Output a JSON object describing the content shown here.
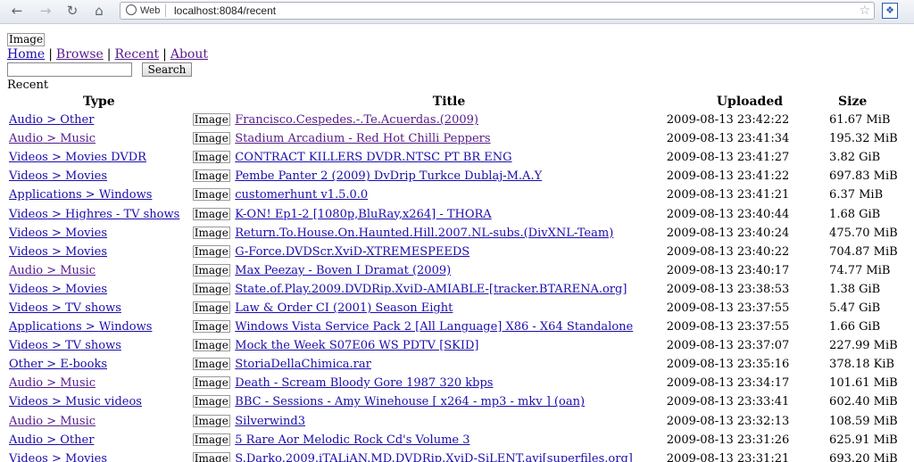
{
  "browser": {
    "url_chip": "Web",
    "url": "localhost:8084/recent"
  },
  "page": {
    "logo_alt": "Image",
    "nav": [
      {
        "label": "Home",
        "visited": false
      },
      {
        "label": "Browse",
        "visited": true
      },
      {
        "label": "Recent",
        "visited": true
      },
      {
        "label": "About",
        "visited": true
      }
    ],
    "search_button": "Search",
    "section_title": "Recent",
    "columns": [
      "Type",
      "Title",
      "Uploaded",
      "Size"
    ],
    "rows": [
      {
        "cat": "Audio",
        "sub": "Other",
        "visited": false,
        "img": "Image",
        "title": "Francisco.Cespedes.-.Te.Acuerdas.(2009)",
        "title_visited": true,
        "uploaded": "2009-08-13 23:42:22",
        "size": "61.67 MiB"
      },
      {
        "cat": "Audio",
        "sub": "Music",
        "visited": true,
        "img": "Image",
        "title": "Stadium Arcadium - Red Hot Chilli Peppers",
        "title_visited": true,
        "uploaded": "2009-08-13 23:41:34",
        "size": "195.32 MiB"
      },
      {
        "cat": "Videos",
        "sub": "Movies DVDR",
        "visited": false,
        "img": "Image",
        "title": "CONTRACT KILLERS DVDR.NTSC PT BR ENG",
        "title_visited": false,
        "uploaded": "2009-08-13 23:41:27",
        "size": "3.82 GiB"
      },
      {
        "cat": "Videos",
        "sub": "Movies",
        "visited": false,
        "img": "Image",
        "title": "Pembe Panter 2 (2009) DvDrip Turkce Dublaj-M.A.Y",
        "title_visited": false,
        "uploaded": "2009-08-13 23:41:22",
        "size": "697.83 MiB"
      },
      {
        "cat": "Applications",
        "sub": "Windows",
        "visited": false,
        "img": "Image",
        "title": "customerhunt v1.5.0.0",
        "title_visited": false,
        "uploaded": "2009-08-13 23:41:21",
        "size": "6.37 MiB"
      },
      {
        "cat": "Videos",
        "sub": "Highres - TV shows",
        "visited": false,
        "img": "Image",
        "title": "K-ON! Ep1-2 [1080p,BluRay,x264] - THORA",
        "title_visited": false,
        "uploaded": "2009-08-13 23:40:44",
        "size": "1.68 GiB"
      },
      {
        "cat": "Videos",
        "sub": "Movies",
        "visited": false,
        "img": "Image",
        "title": "Return.To.House.On.Haunted.Hill.2007.NL-subs.(DivXNL-Team)",
        "title_visited": false,
        "uploaded": "2009-08-13 23:40:24",
        "size": "475.70 MiB"
      },
      {
        "cat": "Videos",
        "sub": "Movies",
        "visited": false,
        "img": "Image",
        "title": "G-Force.DVDScr.XviD-XTREMESPEEDS",
        "title_visited": false,
        "uploaded": "2009-08-13 23:40:22",
        "size": "704.87 MiB"
      },
      {
        "cat": "Audio",
        "sub": "Music",
        "visited": true,
        "img": "Image",
        "title": "Max Peezay - Boven I Dramat (2009)",
        "title_visited": false,
        "uploaded": "2009-08-13 23:40:17",
        "size": "74.77 MiB"
      },
      {
        "cat": "Videos",
        "sub": "Movies",
        "visited": false,
        "img": "Image",
        "title": "State.of.Play.2009.DVDRip.XviD-AMIABLE-[tracker.BTARENA.org]",
        "title_visited": false,
        "uploaded": "2009-08-13 23:38:53",
        "size": "1.38 GiB"
      },
      {
        "cat": "Videos",
        "sub": "TV shows",
        "visited": false,
        "img": "Image",
        "title": "Law & Order CI (2001) Season Eight",
        "title_visited": false,
        "uploaded": "2009-08-13 23:37:55",
        "size": "5.47 GiB"
      },
      {
        "cat": "Applications",
        "sub": "Windows",
        "visited": false,
        "img": "Image",
        "title": "Windows Vista Service Pack 2 [All Language] X86 - X64 Standalone",
        "title_visited": false,
        "uploaded": "2009-08-13 23:37:55",
        "size": "1.66 GiB"
      },
      {
        "cat": "Videos",
        "sub": "TV shows",
        "visited": false,
        "img": "Image",
        "title": "Mock the Week S07E06 WS PDTV [SKID]",
        "title_visited": false,
        "uploaded": "2009-08-13 23:37:07",
        "size": "227.99 MiB"
      },
      {
        "cat": "Other",
        "sub": "E-books",
        "visited": false,
        "img": "Image",
        "title": "StoriaDellaChimica.rar",
        "title_visited": false,
        "uploaded": "2009-08-13 23:35:16",
        "size": "378.18 KiB"
      },
      {
        "cat": "Audio",
        "sub": "Music",
        "visited": true,
        "img": "Image",
        "title": "Death - Scream Bloody Gore 1987 320 kbps",
        "title_visited": false,
        "uploaded": "2009-08-13 23:34:17",
        "size": "101.61 MiB"
      },
      {
        "cat": "Videos",
        "sub": "Music videos",
        "visited": false,
        "img": "Image",
        "title": "BBC - Sessions - Amy Winehouse [ x264 - mp3 - mkv ] (oan)",
        "title_visited": false,
        "uploaded": "2009-08-13 23:33:41",
        "size": "602.40 MiB"
      },
      {
        "cat": "Audio",
        "sub": "Music",
        "visited": true,
        "img": "Image",
        "title": "Silverwind3",
        "title_visited": false,
        "uploaded": "2009-08-13 23:32:13",
        "size": "108.59 MiB"
      },
      {
        "cat": "Audio",
        "sub": "Other",
        "visited": false,
        "img": "Image",
        "title": "5 Rare Aor Melodic Rock Cd's Volume 3",
        "title_visited": false,
        "uploaded": "2009-08-13 23:31:26",
        "size": "625.91 MiB"
      },
      {
        "cat": "Videos",
        "sub": "Movies",
        "visited": false,
        "img": "Image",
        "title": "S.Darko.2009.iTALiAN.MD.DVDRip.XviD-SiLENT.avi[superfiles.org]",
        "title_visited": false,
        "uploaded": "2009-08-13 23:31:21",
        "size": "693.20 MiB"
      }
    ]
  }
}
